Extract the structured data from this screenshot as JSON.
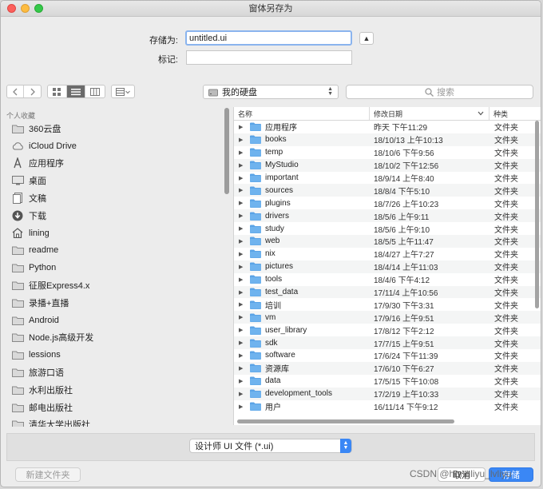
{
  "window": {
    "title": "窗体另存为"
  },
  "form": {
    "save_as_label": "存储为:",
    "save_as_value": "untitled.ui",
    "tags_label": "标记:",
    "tags_value": ""
  },
  "toolbar": {
    "location": "我的硬盘",
    "search_placeholder": "搜索"
  },
  "sidebar": {
    "header": "个人收藏",
    "items": [
      {
        "label": "360云盘",
        "icon": "folder-icon"
      },
      {
        "label": "iCloud Drive",
        "icon": "cloud-icon"
      },
      {
        "label": "应用程序",
        "icon": "applications-icon"
      },
      {
        "label": "桌面",
        "icon": "desktop-icon"
      },
      {
        "label": "文稿",
        "icon": "documents-icon"
      },
      {
        "label": "下载",
        "icon": "download-icon"
      },
      {
        "label": "lining",
        "icon": "home-icon"
      },
      {
        "label": "readme",
        "icon": "folder-icon"
      },
      {
        "label": "Python",
        "icon": "folder-icon"
      },
      {
        "label": "征服Express4.x",
        "icon": "folder-icon"
      },
      {
        "label": "录播+直播",
        "icon": "folder-icon"
      },
      {
        "label": "Android",
        "icon": "folder-icon"
      },
      {
        "label": "Node.js高级开发",
        "icon": "folder-icon"
      },
      {
        "label": "lessions",
        "icon": "folder-icon"
      },
      {
        "label": "旅游口语",
        "icon": "folder-icon"
      },
      {
        "label": "水利出版社",
        "icon": "folder-icon"
      },
      {
        "label": "邮电出版社",
        "icon": "folder-icon"
      },
      {
        "label": "清华大学出版社",
        "icon": "folder-icon"
      }
    ]
  },
  "files": {
    "columns": {
      "name": "名称",
      "date": "修改日期",
      "kind": "种类"
    },
    "rows": [
      {
        "name": "应用程序",
        "date": "昨天 下午11:29",
        "kind": "文件夹"
      },
      {
        "name": "books",
        "date": "18/10/13 上午10:13",
        "kind": "文件夹"
      },
      {
        "name": "temp",
        "date": "18/10/6 下午9:56",
        "kind": "文件夹"
      },
      {
        "name": "MyStudio",
        "date": "18/10/2 下午12:56",
        "kind": "文件夹"
      },
      {
        "name": "important",
        "date": "18/9/14 上午8:40",
        "kind": "文件夹"
      },
      {
        "name": "sources",
        "date": "18/8/4 下午5:10",
        "kind": "文件夹"
      },
      {
        "name": "plugins",
        "date": "18/7/26 上午10:23",
        "kind": "文件夹"
      },
      {
        "name": "drivers",
        "date": "18/5/6 上午9:11",
        "kind": "文件夹"
      },
      {
        "name": "study",
        "date": "18/5/6 上午9:10",
        "kind": "文件夹"
      },
      {
        "name": "web",
        "date": "18/5/5 上午11:47",
        "kind": "文件夹"
      },
      {
        "name": "nix",
        "date": "18/4/27 上午7:27",
        "kind": "文件夹"
      },
      {
        "name": "pictures",
        "date": "18/4/14 上午11:03",
        "kind": "文件夹"
      },
      {
        "name": "tools",
        "date": "18/4/6 下午4:12",
        "kind": "文件夹"
      },
      {
        "name": "test_data",
        "date": "17/11/4 上午10:56",
        "kind": "文件夹"
      },
      {
        "name": "培训",
        "date": "17/9/30 下午3:31",
        "kind": "文件夹"
      },
      {
        "name": "vm",
        "date": "17/9/16 上午9:51",
        "kind": "文件夹"
      },
      {
        "name": "user_library",
        "date": "17/8/12 下午2:12",
        "kind": "文件夹"
      },
      {
        "name": "sdk",
        "date": "17/7/15 上午9:51",
        "kind": "文件夹"
      },
      {
        "name": "software",
        "date": "17/6/24 下午11:39",
        "kind": "文件夹"
      },
      {
        "name": "资源库",
        "date": "17/6/10 下午6:27",
        "kind": "文件夹"
      },
      {
        "name": "data",
        "date": "17/5/15 下午10:08",
        "kind": "文件夹"
      },
      {
        "name": "development_tools",
        "date": "17/2/19 上午10:33",
        "kind": "文件夹"
      },
      {
        "name": "用户",
        "date": "16/11/14 下午9:12",
        "kind": "文件夹"
      }
    ]
  },
  "footer": {
    "format": "设计师 UI 文件 (*.ui)",
    "new_folder": "新建文件夹",
    "cancel": "取消",
    "save": "存储"
  },
  "watermark": "CSDN @hongliyu_lvliyu",
  "colors": {
    "accent": "#3a87f5",
    "folder": "#5aa3e6"
  }
}
